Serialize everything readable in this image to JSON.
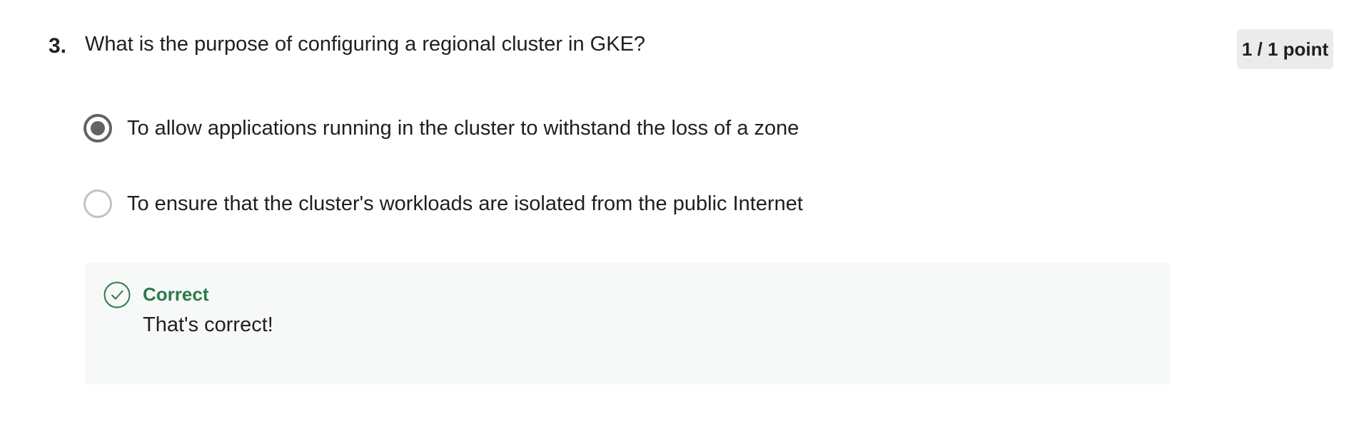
{
  "question": {
    "number": "3.",
    "text": "What is the purpose of configuring a regional cluster in GKE?"
  },
  "score": {
    "label": "1 / 1 point"
  },
  "options": [
    {
      "label": "To allow applications running in the cluster to withstand the loss of a zone",
      "selected": true
    },
    {
      "label": "To ensure that the cluster's workloads are isolated from the public Internet",
      "selected": false
    }
  ],
  "feedback": {
    "title": "Correct",
    "text": "That's correct!",
    "icon": "check-circle-icon"
  },
  "colors": {
    "correct_green": "#2e7a4b",
    "radio_selected": "#636363",
    "radio_unselected": "#c2c2c2",
    "badge_bg": "#ebebeb",
    "feedback_bg": "#f7f9f8"
  }
}
